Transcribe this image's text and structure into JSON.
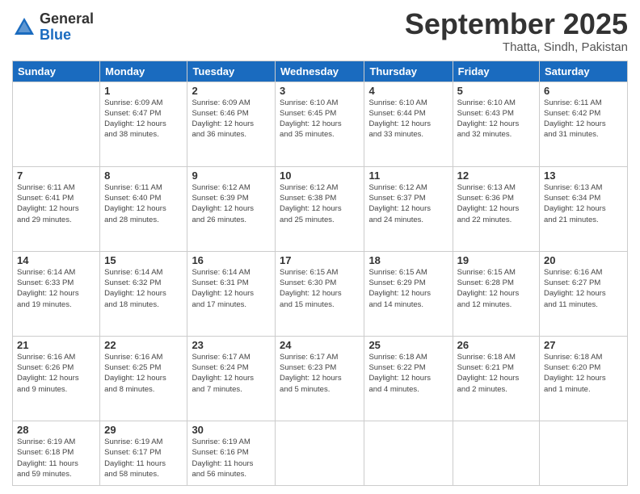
{
  "logo": {
    "general": "General",
    "blue": "Blue"
  },
  "header": {
    "month": "September 2025",
    "location": "Thatta, Sindh, Pakistan"
  },
  "weekdays": [
    "Sunday",
    "Monday",
    "Tuesday",
    "Wednesday",
    "Thursday",
    "Friday",
    "Saturday"
  ],
  "weeks": [
    [
      {
        "day": "",
        "detail": ""
      },
      {
        "day": "1",
        "detail": "Sunrise: 6:09 AM\nSunset: 6:47 PM\nDaylight: 12 hours\nand 38 minutes."
      },
      {
        "day": "2",
        "detail": "Sunrise: 6:09 AM\nSunset: 6:46 PM\nDaylight: 12 hours\nand 36 minutes."
      },
      {
        "day": "3",
        "detail": "Sunrise: 6:10 AM\nSunset: 6:45 PM\nDaylight: 12 hours\nand 35 minutes."
      },
      {
        "day": "4",
        "detail": "Sunrise: 6:10 AM\nSunset: 6:44 PM\nDaylight: 12 hours\nand 33 minutes."
      },
      {
        "day": "5",
        "detail": "Sunrise: 6:10 AM\nSunset: 6:43 PM\nDaylight: 12 hours\nand 32 minutes."
      },
      {
        "day": "6",
        "detail": "Sunrise: 6:11 AM\nSunset: 6:42 PM\nDaylight: 12 hours\nand 31 minutes."
      }
    ],
    [
      {
        "day": "7",
        "detail": "Sunrise: 6:11 AM\nSunset: 6:41 PM\nDaylight: 12 hours\nand 29 minutes."
      },
      {
        "day": "8",
        "detail": "Sunrise: 6:11 AM\nSunset: 6:40 PM\nDaylight: 12 hours\nand 28 minutes."
      },
      {
        "day": "9",
        "detail": "Sunrise: 6:12 AM\nSunset: 6:39 PM\nDaylight: 12 hours\nand 26 minutes."
      },
      {
        "day": "10",
        "detail": "Sunrise: 6:12 AM\nSunset: 6:38 PM\nDaylight: 12 hours\nand 25 minutes."
      },
      {
        "day": "11",
        "detail": "Sunrise: 6:12 AM\nSunset: 6:37 PM\nDaylight: 12 hours\nand 24 minutes."
      },
      {
        "day": "12",
        "detail": "Sunrise: 6:13 AM\nSunset: 6:36 PM\nDaylight: 12 hours\nand 22 minutes."
      },
      {
        "day": "13",
        "detail": "Sunrise: 6:13 AM\nSunset: 6:34 PM\nDaylight: 12 hours\nand 21 minutes."
      }
    ],
    [
      {
        "day": "14",
        "detail": "Sunrise: 6:14 AM\nSunset: 6:33 PM\nDaylight: 12 hours\nand 19 minutes."
      },
      {
        "day": "15",
        "detail": "Sunrise: 6:14 AM\nSunset: 6:32 PM\nDaylight: 12 hours\nand 18 minutes."
      },
      {
        "day": "16",
        "detail": "Sunrise: 6:14 AM\nSunset: 6:31 PM\nDaylight: 12 hours\nand 17 minutes."
      },
      {
        "day": "17",
        "detail": "Sunrise: 6:15 AM\nSunset: 6:30 PM\nDaylight: 12 hours\nand 15 minutes."
      },
      {
        "day": "18",
        "detail": "Sunrise: 6:15 AM\nSunset: 6:29 PM\nDaylight: 12 hours\nand 14 minutes."
      },
      {
        "day": "19",
        "detail": "Sunrise: 6:15 AM\nSunset: 6:28 PM\nDaylight: 12 hours\nand 12 minutes."
      },
      {
        "day": "20",
        "detail": "Sunrise: 6:16 AM\nSunset: 6:27 PM\nDaylight: 12 hours\nand 11 minutes."
      }
    ],
    [
      {
        "day": "21",
        "detail": "Sunrise: 6:16 AM\nSunset: 6:26 PM\nDaylight: 12 hours\nand 9 minutes."
      },
      {
        "day": "22",
        "detail": "Sunrise: 6:16 AM\nSunset: 6:25 PM\nDaylight: 12 hours\nand 8 minutes."
      },
      {
        "day": "23",
        "detail": "Sunrise: 6:17 AM\nSunset: 6:24 PM\nDaylight: 12 hours\nand 7 minutes."
      },
      {
        "day": "24",
        "detail": "Sunrise: 6:17 AM\nSunset: 6:23 PM\nDaylight: 12 hours\nand 5 minutes."
      },
      {
        "day": "25",
        "detail": "Sunrise: 6:18 AM\nSunset: 6:22 PM\nDaylight: 12 hours\nand 4 minutes."
      },
      {
        "day": "26",
        "detail": "Sunrise: 6:18 AM\nSunset: 6:21 PM\nDaylight: 12 hours\nand 2 minutes."
      },
      {
        "day": "27",
        "detail": "Sunrise: 6:18 AM\nSunset: 6:20 PM\nDaylight: 12 hours\nand 1 minute."
      }
    ],
    [
      {
        "day": "28",
        "detail": "Sunrise: 6:19 AM\nSunset: 6:18 PM\nDaylight: 11 hours\nand 59 minutes."
      },
      {
        "day": "29",
        "detail": "Sunrise: 6:19 AM\nSunset: 6:17 PM\nDaylight: 11 hours\nand 58 minutes."
      },
      {
        "day": "30",
        "detail": "Sunrise: 6:19 AM\nSunset: 6:16 PM\nDaylight: 11 hours\nand 56 minutes."
      },
      {
        "day": "",
        "detail": ""
      },
      {
        "day": "",
        "detail": ""
      },
      {
        "day": "",
        "detail": ""
      },
      {
        "day": "",
        "detail": ""
      }
    ]
  ]
}
